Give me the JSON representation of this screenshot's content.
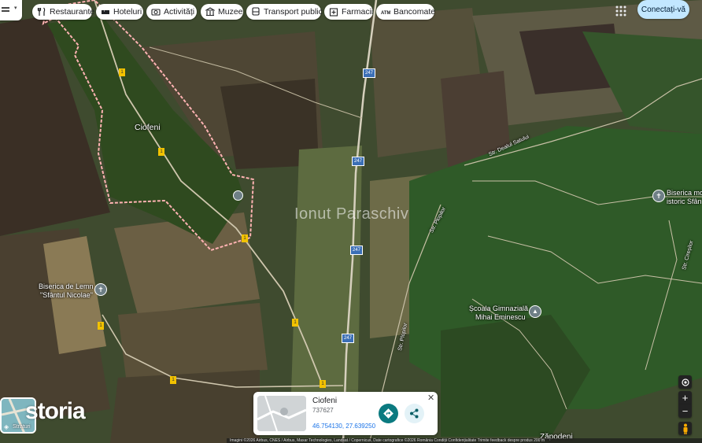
{
  "search_bar": {
    "chips": [
      {
        "label": "Restaurante",
        "icon": "fork-knife-icon"
      },
      {
        "label": "Hoteluri",
        "icon": "bed-icon"
      },
      {
        "label": "Activități",
        "icon": "camera-icon"
      },
      {
        "label": "Muzee",
        "icon": "museum-icon"
      },
      {
        "label": "Transport public",
        "icon": "bus-icon"
      },
      {
        "label": "Farmacii",
        "icon": "pharmacy-icon"
      },
      {
        "label": "Bancomate",
        "icon": "atm-icon"
      }
    ]
  },
  "header": {
    "sign_in_label": "Conectați-vă",
    "apps_icon": "grid-icon"
  },
  "map": {
    "watermark": "Ionut Paraschiv",
    "place_labels": {
      "village": "Ciofeni",
      "church_wood_line1": "Biserica de Lemn",
      "church_wood_line2": "\"Sfântul Nicolae\"",
      "school_line1": "Școala Gimnazială",
      "school_line2": "Mihai Eminescu",
      "church_right_line1": "Biserica mo",
      "church_right_line2": "istoric Sfân",
      "zapodeni": "Zăpodeni"
    },
    "street_labels": {
      "dealul_satului": "Str. Dealul Satului",
      "plopilor_north": "Str. Plopilor",
      "plopilor_south": "Str. Plopilor",
      "cireșilor": "Str. Cireșilor"
    },
    "road_shields": {
      "main": "247",
      "county": "1"
    },
    "colors": {
      "boundary": "#ffb3b3",
      "road": "#d9d3c0",
      "shield_yellow": "#f2c200",
      "shield_blue": "#3b6fb6"
    }
  },
  "info_card": {
    "name": "Ciofeni",
    "code": "737627",
    "coordinates": "46.754130, 27.639250",
    "close_icon": "close-icon",
    "directions_icon": "directions-icon",
    "share_icon": "share-icon"
  },
  "layers": {
    "label": "Straturi"
  },
  "brand": {
    "logo_text": "storia"
  },
  "controls": {
    "zoom_in": "+",
    "zoom_out": "−",
    "location_icon": "my-location-icon",
    "pegman_icon": "pegman-icon"
  },
  "footer": {
    "text": "Imagini ©2026 Airbus, CNES / Airbus, Maxar Technologies, Landsat / Copernicus, Date cartografice ©2026   România   Condiții   Confidențialitate   Trimite feedback despre produs   200 m"
  }
}
